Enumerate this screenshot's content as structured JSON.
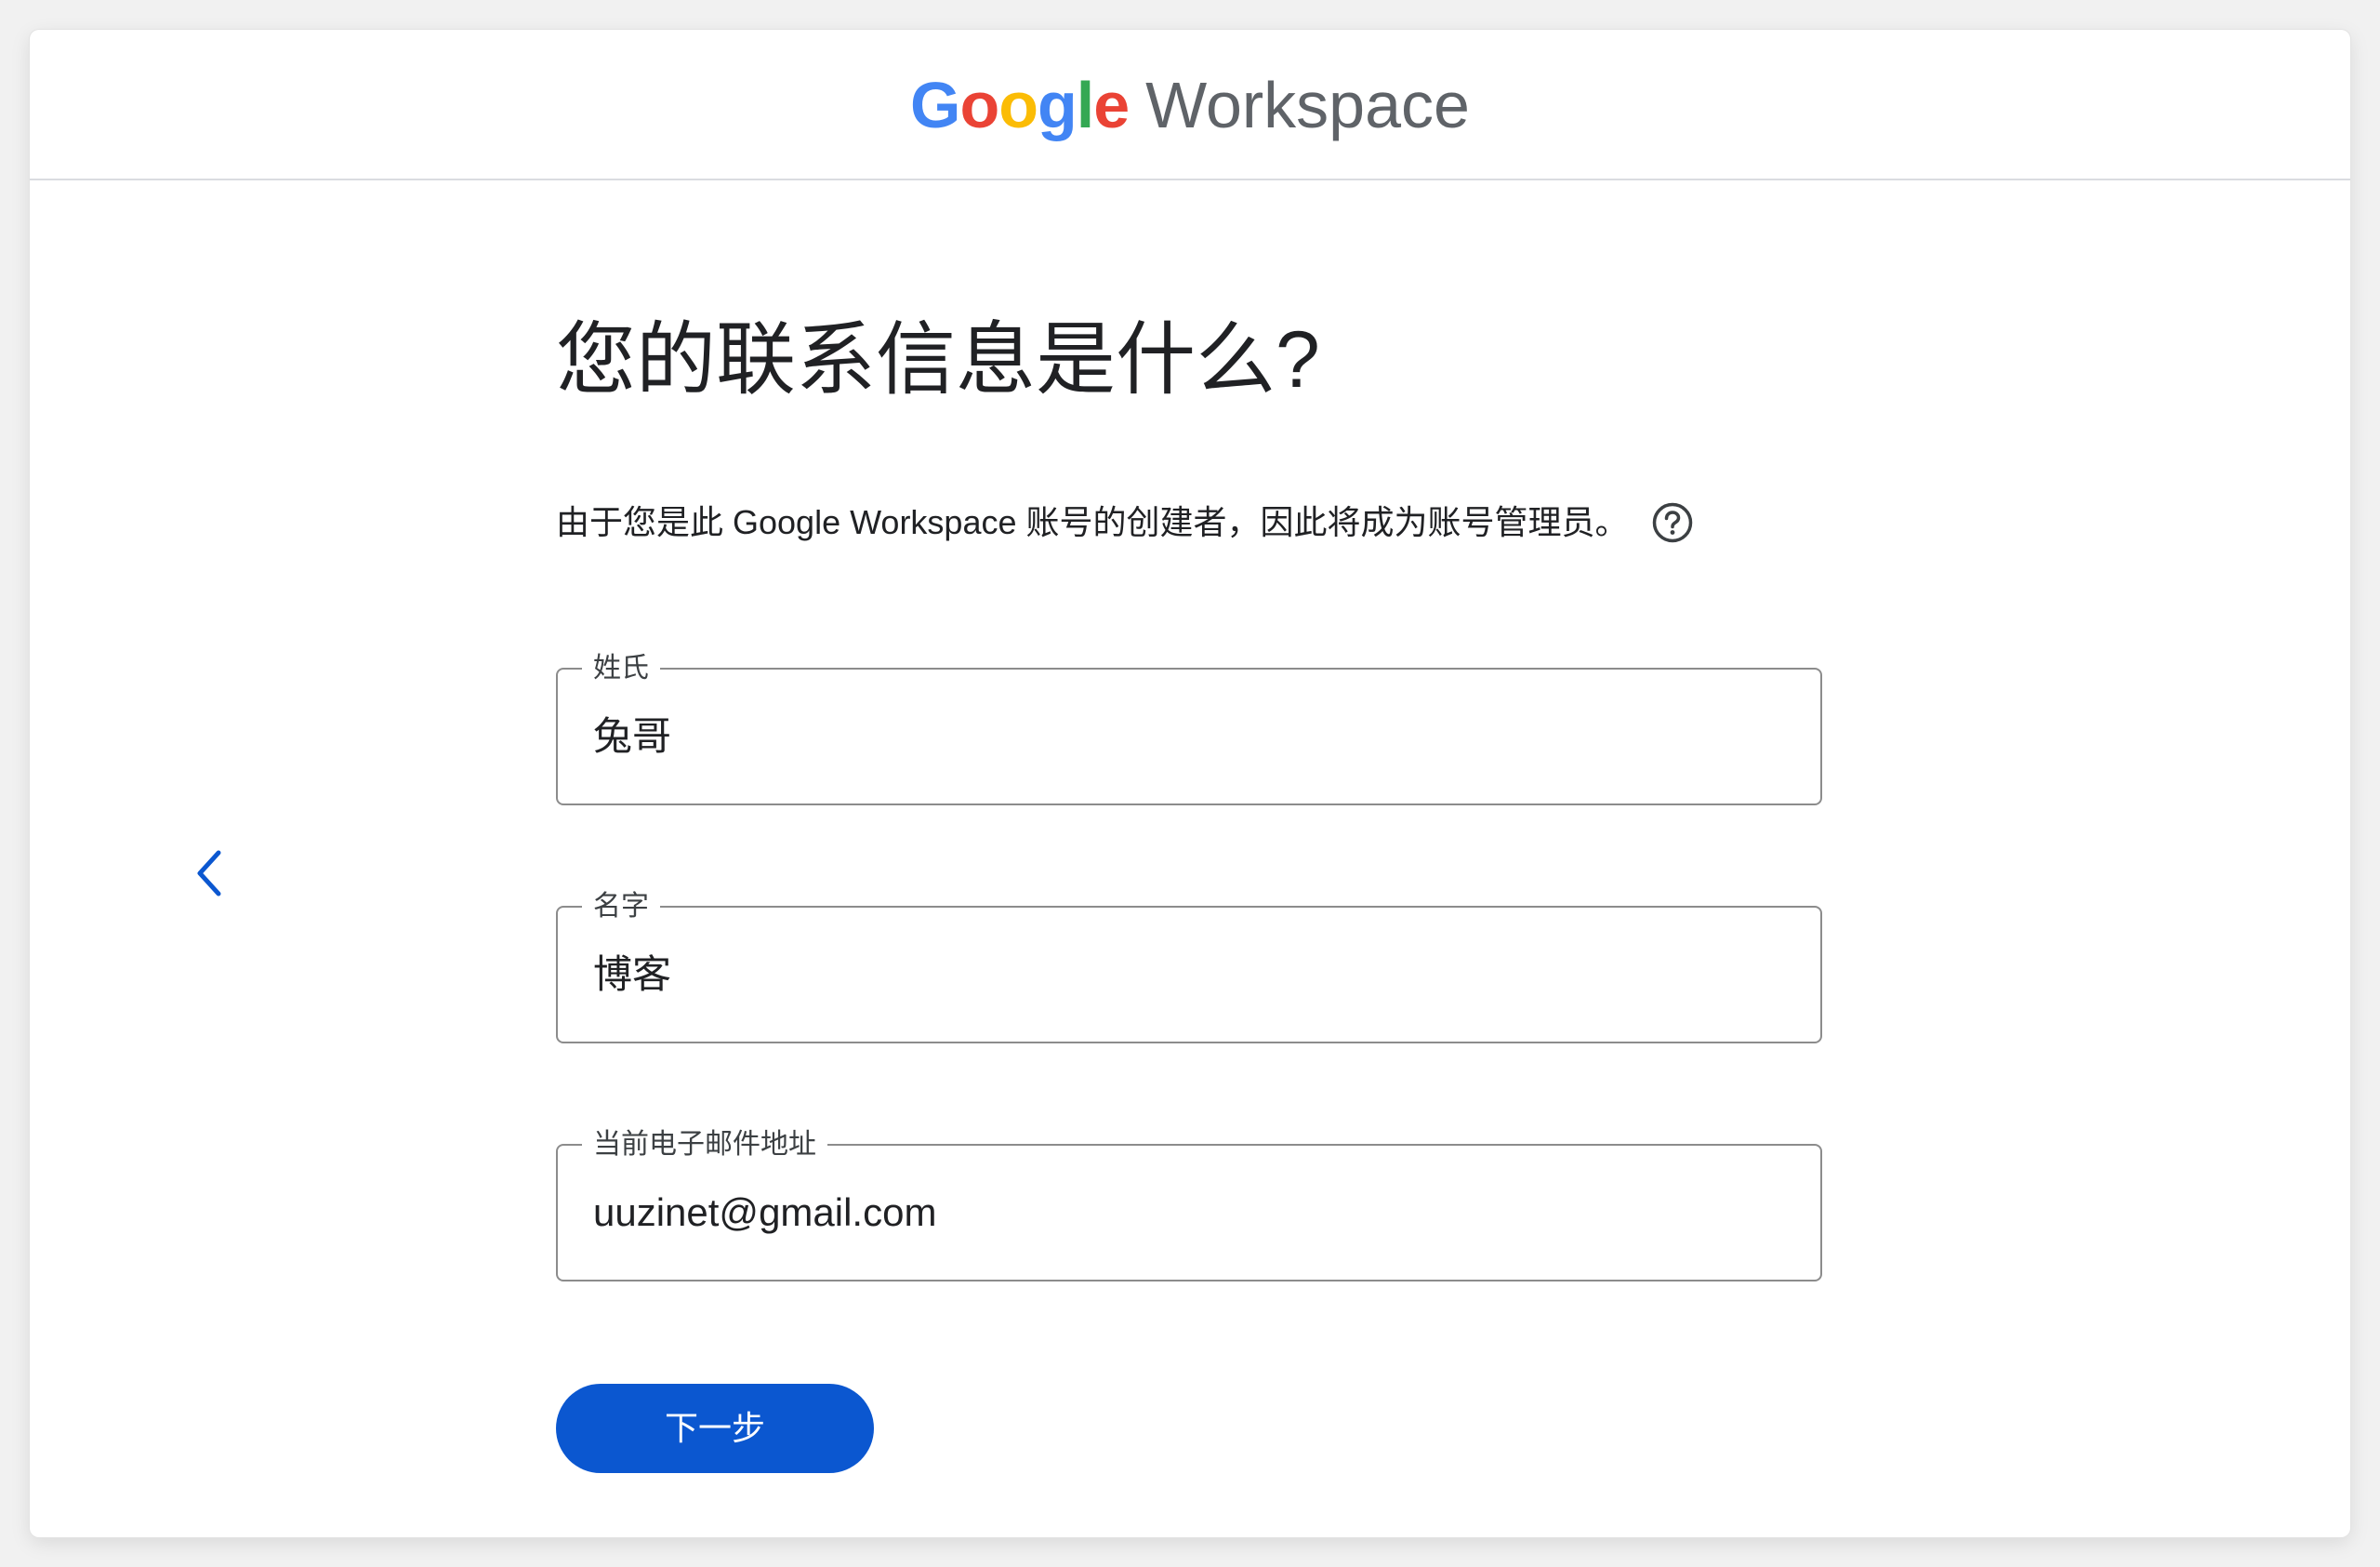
{
  "header": {
    "brand_google_letters": [
      "G",
      "o",
      "o",
      "g",
      "l",
      "e"
    ],
    "brand_product": "Workspace",
    "brand_colors": {
      "blue": "#4285F4",
      "red": "#EA4335",
      "yellow": "#FBBC05",
      "green": "#34A853",
      "gray": "#5f6368"
    }
  },
  "nav": {
    "back_icon": "chevron-left-icon",
    "accent_color": "#0b57d0"
  },
  "main": {
    "title": "您的联系信息是什么?",
    "description": "由于您是此 Google Workspace 账号的创建者，因此将成为账号管理员。",
    "help_icon": "help-circle-icon",
    "fields": [
      {
        "label": "姓氏",
        "value": "兔哥"
      },
      {
        "label": "名字",
        "value": "博客"
      },
      {
        "label": "当前电子邮件地址",
        "value": "uuzinet@gmail.com"
      }
    ],
    "next_button": "下一步"
  }
}
